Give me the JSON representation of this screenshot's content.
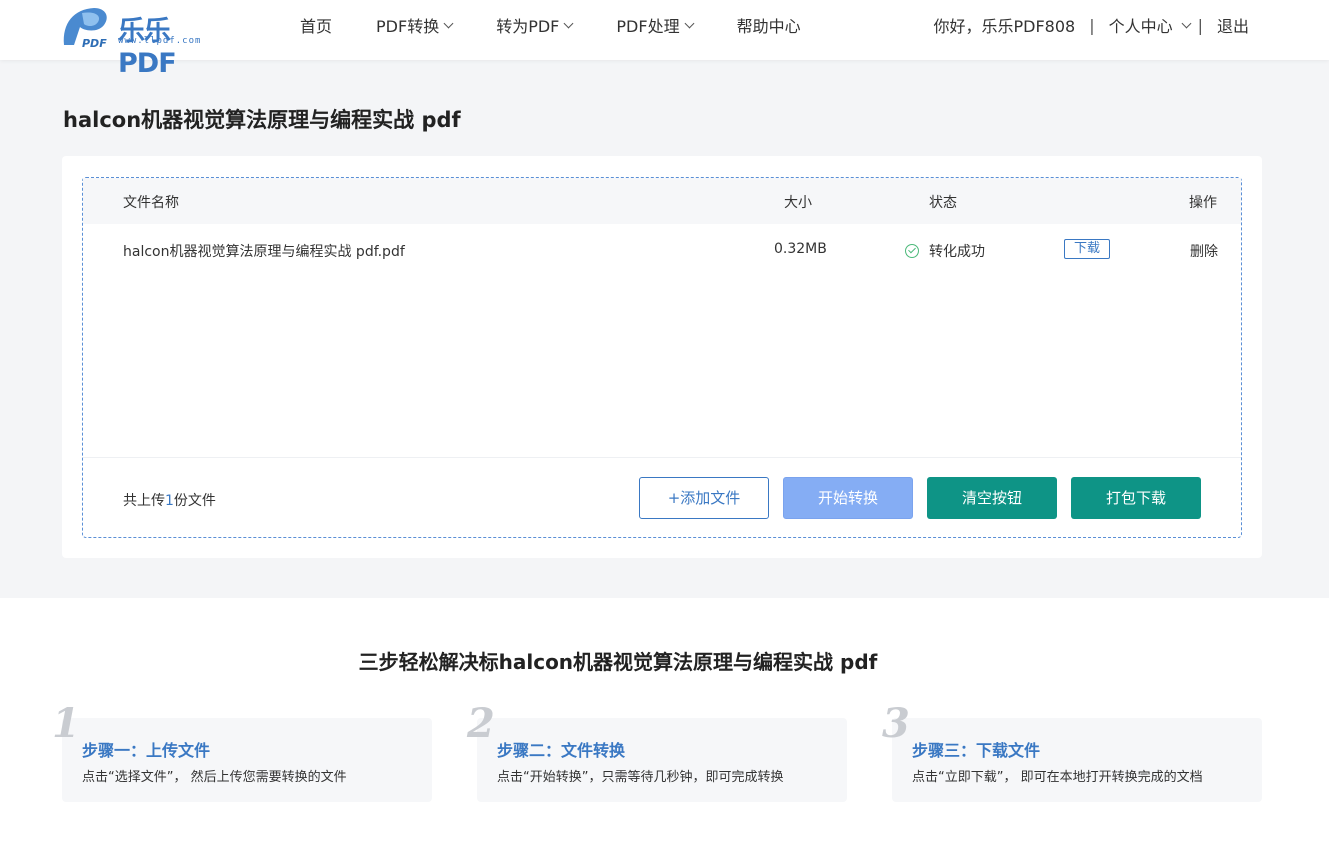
{
  "logo": {
    "brand": "乐乐PDF",
    "url": "www.llpdf.com",
    "mark": "PDF"
  },
  "nav": {
    "items": [
      {
        "label": "首页",
        "dropdown": false
      },
      {
        "label": "PDF转换",
        "dropdown": true
      },
      {
        "label": "转为PDF",
        "dropdown": true
      },
      {
        "label": "PDF处理",
        "dropdown": true
      },
      {
        "label": "帮助中心",
        "dropdown": false
      }
    ]
  },
  "user": {
    "greeting": "你好，乐乐PDF808",
    "separator": "|",
    "center": "个人中心",
    "logout": "退出"
  },
  "page_title": "halcon机器视觉算法原理与编程实战 pdf",
  "table": {
    "headers": {
      "name": "文件名称",
      "size": "大小",
      "status": "状态",
      "action": "操作"
    },
    "rows": [
      {
        "name": "halcon机器视觉算法原理与编程实战 pdf.pdf",
        "size": "0.32MB",
        "status": "转化成功",
        "download": "下载",
        "delete": "删除"
      }
    ]
  },
  "summary": {
    "prefix": "共上传",
    "count": "1",
    "suffix": "份文件"
  },
  "buttons": {
    "add": "+添加文件",
    "start": "开始转换",
    "clear": "清空按钮",
    "pack": "打包下载"
  },
  "steps_title": "三步轻松解决标halcon机器视觉算法原理与编程实战 pdf",
  "steps": [
    {
      "num": "1",
      "title": "步骤一：上传文件",
      "desc": "点击“选择文件”， 然后上传您需要转换的文件"
    },
    {
      "num": "2",
      "title": "步骤二：文件转换",
      "desc": "点击“开始转换”，只需等待几秒钟，即可完成转换"
    },
    {
      "num": "3",
      "title": "步骤三：下载文件",
      "desc": "点击“立即下载”， 即可在本地打开转换完成的文档"
    }
  ],
  "colors": {
    "accent": "#3a78c3",
    "teal": "#0e9486",
    "start_disabled": "#85adf4",
    "success": "#4cb97a"
  }
}
